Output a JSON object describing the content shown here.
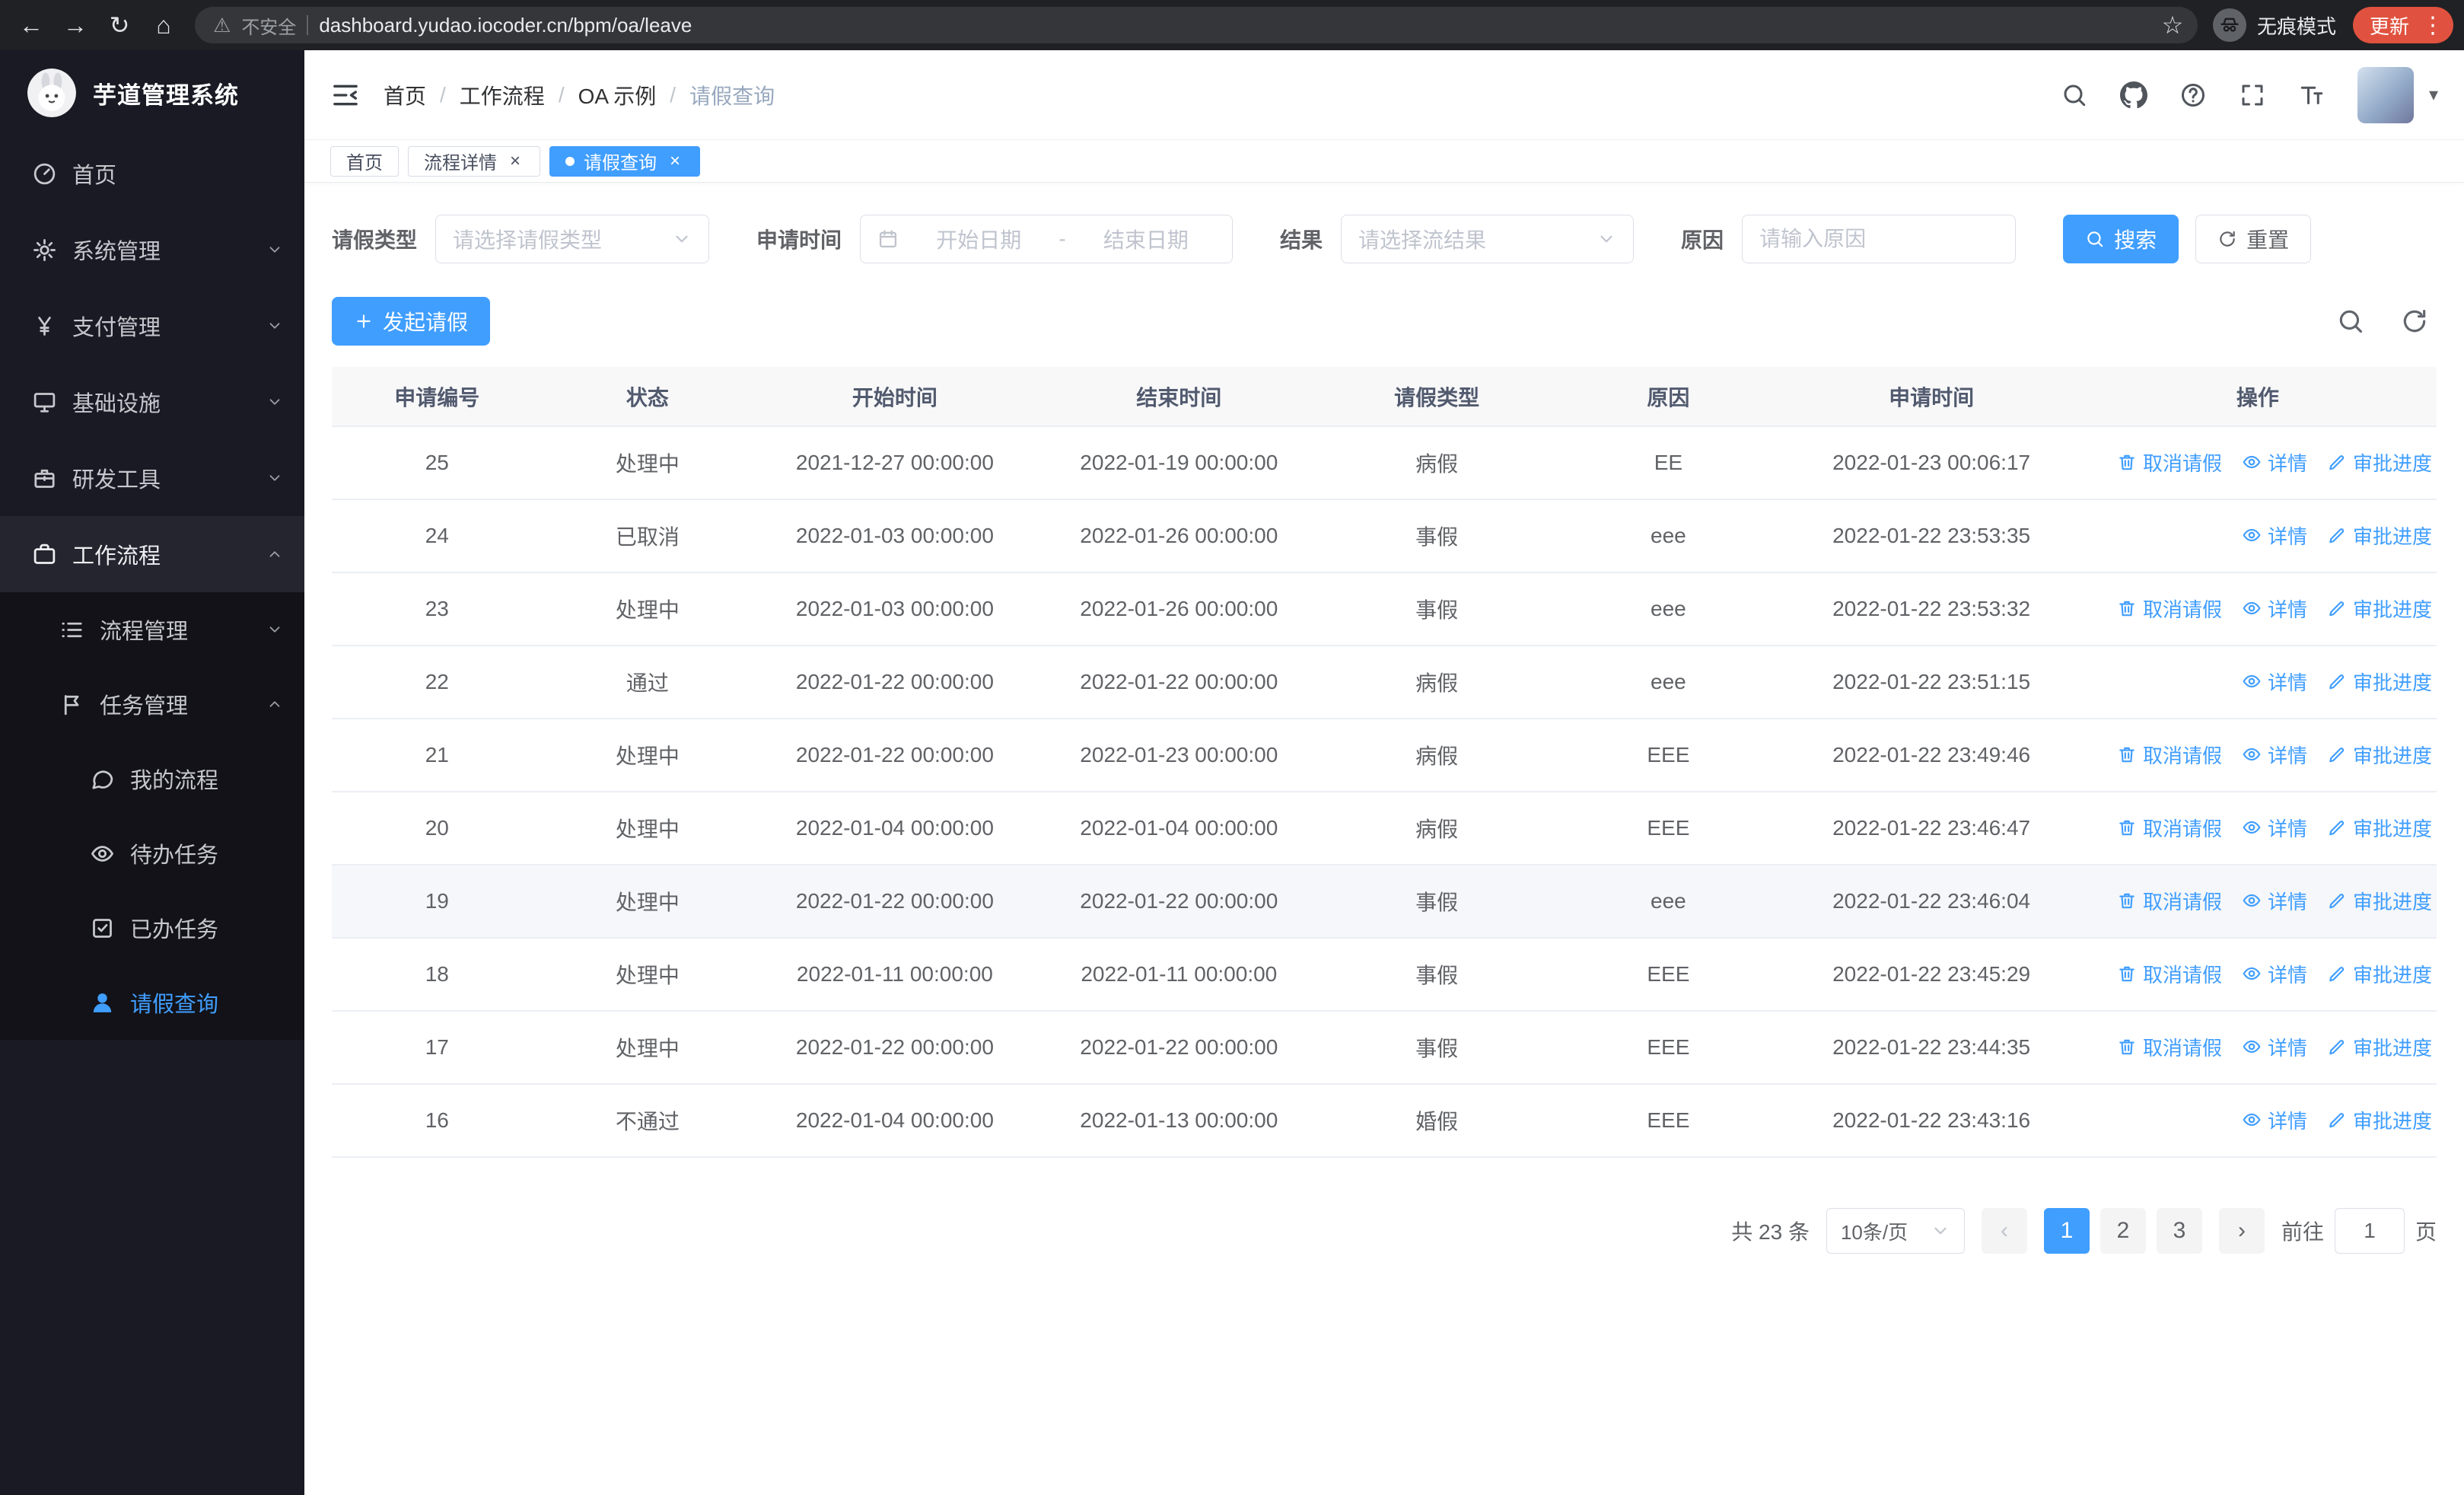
{
  "colors": {
    "primary": "#409eff",
    "update_badge": "#e0523f",
    "sidebar_bg": "#191a23"
  },
  "browser": {
    "security_label": "不安全",
    "url": "dashboard.yudao.iocoder.cn/bpm/oa/leave",
    "incognito_label": "无痕模式",
    "update_label": "更新"
  },
  "sidebar": {
    "app_title": "芋道管理系统",
    "menu": [
      {
        "key": "home",
        "label": "首页",
        "icon": "dashboard"
      },
      {
        "key": "system-mgmt",
        "label": "系统管理",
        "icon": "gear",
        "arrow": "down"
      },
      {
        "key": "payment-mgmt",
        "label": "支付管理",
        "icon": "yen",
        "arrow": "down"
      },
      {
        "key": "infrastructure",
        "label": "基础设施",
        "icon": "monitor",
        "arrow": "down"
      },
      {
        "key": "dev-tools",
        "label": "研发工具",
        "icon": "toolbox",
        "arrow": "down"
      },
      {
        "key": "workflow",
        "label": "工作流程",
        "icon": "briefcase",
        "arrow": "up",
        "expanded": true,
        "children": [
          {
            "key": "process-mgmt",
            "label": "流程管理",
            "icon": "list",
            "arrow": "down"
          },
          {
            "key": "task-mgmt",
            "label": "任务管理",
            "icon": "flag",
            "arrow": "up",
            "expanded": true,
            "children": [
              {
                "key": "my-process",
                "label": "我的流程",
                "icon": "chat"
              },
              {
                "key": "todo-tasks",
                "label": "待办任务",
                "icon": "eye"
              },
              {
                "key": "done-tasks",
                "label": "已办任务",
                "icon": "checksquare"
              },
              {
                "key": "leave-query",
                "label": "请假查询",
                "icon": "user",
                "active": true
              }
            ]
          }
        ]
      }
    ]
  },
  "navbar": {
    "breadcrumb": [
      {
        "label": "首页"
      },
      {
        "label": "工作流程"
      },
      {
        "label": "OA 示例"
      },
      {
        "label": "请假查询",
        "current": true
      }
    ]
  },
  "tabs": [
    {
      "key": "home",
      "label": "首页",
      "closable": false,
      "active": false
    },
    {
      "key": "process-detail",
      "label": "流程详情",
      "closable": true,
      "active": false
    },
    {
      "key": "leave-query",
      "label": "请假查询",
      "closable": true,
      "active": true
    }
  ],
  "filters": {
    "leave_type_label": "请假类型",
    "leave_type_placeholder": "请选择请假类型",
    "apply_time_label": "申请时间",
    "start_date_placeholder": "开始日期",
    "range_separator": "-",
    "end_date_placeholder": "结束日期",
    "result_label": "结果",
    "result_placeholder": "请选择流结果",
    "reason_label": "原因",
    "reason_placeholder": "请输入原因",
    "search_button": "搜索",
    "reset_button": "重置"
  },
  "toolbar": {
    "create_label": "发起请假"
  },
  "table": {
    "columns": [
      "申请编号",
      "状态",
      "开始时间",
      "结束时间",
      "请假类型",
      "原因",
      "申请时间",
      "操作"
    ],
    "action_labels": {
      "cancel": "取消请假",
      "detail": "详情",
      "progress": "审批进度"
    },
    "highlighted_id": "19",
    "rows": [
      {
        "id": "25",
        "status": "处理中",
        "start": "2021-12-27 00:00:00",
        "end": "2022-01-19 00:00:00",
        "type": "病假",
        "reason": "EE",
        "applied": "2022-01-23 00:06:17",
        "actions": [
          "cancel",
          "detail",
          "progress"
        ]
      },
      {
        "id": "24",
        "status": "已取消",
        "start": "2022-01-03 00:00:00",
        "end": "2022-01-26 00:00:00",
        "type": "事假",
        "reason": "eee",
        "applied": "2022-01-22 23:53:35",
        "actions": [
          "detail",
          "progress"
        ]
      },
      {
        "id": "23",
        "status": "处理中",
        "start": "2022-01-03 00:00:00",
        "end": "2022-01-26 00:00:00",
        "type": "事假",
        "reason": "eee",
        "applied": "2022-01-22 23:53:32",
        "actions": [
          "cancel",
          "detail",
          "progress"
        ]
      },
      {
        "id": "22",
        "status": "通过",
        "start": "2022-01-22 00:00:00",
        "end": "2022-01-22 00:00:00",
        "type": "病假",
        "reason": "eee",
        "applied": "2022-01-22 23:51:15",
        "actions": [
          "detail",
          "progress"
        ]
      },
      {
        "id": "21",
        "status": "处理中",
        "start": "2022-01-22 00:00:00",
        "end": "2022-01-23 00:00:00",
        "type": "病假",
        "reason": "EEE",
        "applied": "2022-01-22 23:49:46",
        "actions": [
          "cancel",
          "detail",
          "progress"
        ]
      },
      {
        "id": "20",
        "status": "处理中",
        "start": "2022-01-04 00:00:00",
        "end": "2022-01-04 00:00:00",
        "type": "病假",
        "reason": "EEE",
        "applied": "2022-01-22 23:46:47",
        "actions": [
          "cancel",
          "detail",
          "progress"
        ]
      },
      {
        "id": "19",
        "status": "处理中",
        "start": "2022-01-22 00:00:00",
        "end": "2022-01-22 00:00:00",
        "type": "事假",
        "reason": "eee",
        "applied": "2022-01-22 23:46:04",
        "actions": [
          "cancel",
          "detail",
          "progress"
        ]
      },
      {
        "id": "18",
        "status": "处理中",
        "start": "2022-01-11 00:00:00",
        "end": "2022-01-11 00:00:00",
        "type": "事假",
        "reason": "EEE",
        "applied": "2022-01-22 23:45:29",
        "actions": [
          "cancel",
          "detail",
          "progress"
        ]
      },
      {
        "id": "17",
        "status": "处理中",
        "start": "2022-01-22 00:00:00",
        "end": "2022-01-22 00:00:00",
        "type": "事假",
        "reason": "EEE",
        "applied": "2022-01-22 23:44:35",
        "actions": [
          "cancel",
          "detail",
          "progress"
        ]
      },
      {
        "id": "16",
        "status": "不通过",
        "start": "2022-01-04 00:00:00",
        "end": "2022-01-13 00:00:00",
        "type": "婚假",
        "reason": "EEE",
        "applied": "2022-01-22 23:43:16",
        "actions": [
          "detail",
          "progress"
        ]
      }
    ]
  },
  "pagination": {
    "total_label": "共 23 条",
    "page_size_label": "10条/页",
    "pages": [
      "1",
      "2",
      "3"
    ],
    "active_page": "1",
    "prev_char": "‹",
    "next_char": "›",
    "goto_prefix": "前往",
    "goto_value": "1",
    "goto_suffix": "页"
  }
}
